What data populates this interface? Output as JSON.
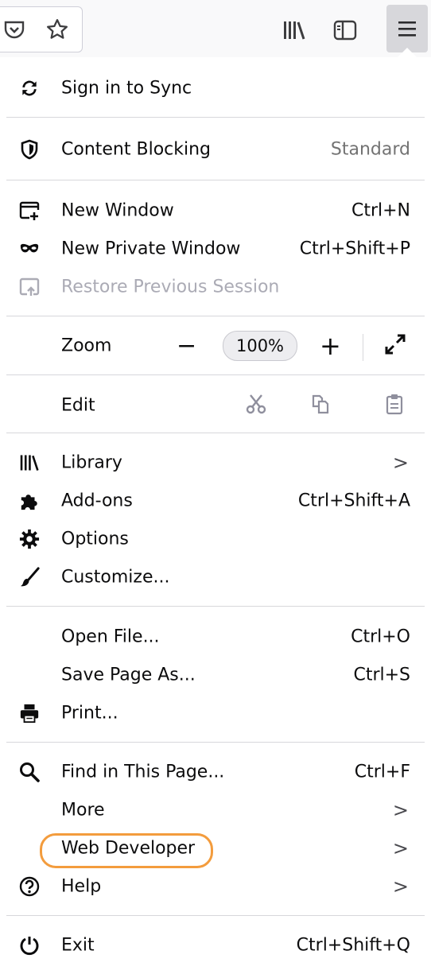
{
  "toolbar": {
    "pocket_icon": "pocket-icon",
    "bookmark_icon": "star-icon",
    "library_icon": "library-icon",
    "sidebar_icon": "sidebar-icon",
    "menu_icon": "hamburger-menu-icon"
  },
  "menu": {
    "sync": {
      "label": "Sign in to Sync",
      "icon": "sync-icon"
    },
    "content_blocking": {
      "label": "Content Blocking",
      "value": "Standard",
      "icon": "shield-icon"
    },
    "new_window": {
      "label": "New Window",
      "shortcut": "Ctrl+N",
      "icon": "new-window-icon"
    },
    "new_private_window": {
      "label": "New Private Window",
      "shortcut": "Ctrl+Shift+P",
      "icon": "private-mask-icon"
    },
    "restore_session": {
      "label": "Restore Previous Session",
      "icon": "restore-session-icon",
      "disabled": true
    },
    "zoom": {
      "label": "Zoom",
      "minus": "−",
      "value": "100%",
      "plus": "+"
    },
    "edit": {
      "label": "Edit"
    },
    "library": {
      "label": "Library",
      "chevron": ">"
    },
    "addons": {
      "label": "Add-ons",
      "shortcut": "Ctrl+Shift+A"
    },
    "options": {
      "label": "Options"
    },
    "customize": {
      "label": "Customize..."
    },
    "open_file": {
      "label": "Open File...",
      "shortcut": "Ctrl+O"
    },
    "save_page": {
      "label": "Save Page As...",
      "shortcut": "Ctrl+S"
    },
    "print": {
      "label": "Print..."
    },
    "find": {
      "label": "Find in This Page...",
      "shortcut": "Ctrl+F"
    },
    "more": {
      "label": "More",
      "chevron": ">"
    },
    "web_developer": {
      "label": "Web Developer",
      "chevron": ">",
      "highlight_color": "#f39c3d"
    },
    "help": {
      "label": "Help",
      "chevron": ">"
    },
    "exit": {
      "label": "Exit",
      "shortcut": "Ctrl+Shift+Q"
    }
  }
}
